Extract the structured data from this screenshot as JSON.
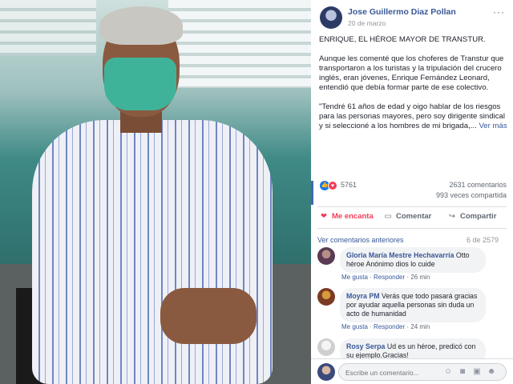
{
  "post": {
    "author": "Jose Guillermo Diaz Pollan",
    "date": "20 de marzo",
    "more": "···",
    "title": "ENRIQUE, EL HÉROE MAYOR DE TRANSTUR.",
    "paragraph1": "Aunque les comenté que los choferes de Transtur que transportaron a los turistas y la tripulación del crucero inglés, eran jóvenes, Enrique Fernández Leonard, entendió que debía formar parte de ese colectivo.",
    "paragraph2": "\"Tendré 61 años de edad y oigo hablar de los riesgos para las personas mayores, pero soy dirigente sindical y si seleccioné a los hombres de mi brigada,...",
    "see_more": "Ver más",
    "reactions": "5761",
    "comments_count": "2631 comentarios",
    "shares_count": "993 veces compartida"
  },
  "actions": {
    "like": "Me encanta",
    "comment": "Comentar",
    "share": "Compartir"
  },
  "comments_header": {
    "previous": "Ver comentarios anteriores",
    "count": "6 de 2579"
  },
  "comments": [
    {
      "name": "Gloria María Mestre Hechavarría",
      "text": "Otto héroe Anónimo dios lo cuide",
      "like": "Me gusta",
      "reply": "Responder",
      "time": "26 min"
    },
    {
      "name": "Moyra PM",
      "text": "Verás que todo pasará gracias por ayudar aquella personas sin duda un acto de humanidad",
      "like": "Me gusta",
      "reply": "Responder",
      "time": "24 min"
    },
    {
      "name": "Rosy Serpa",
      "text": "Ud es un héroe, predicó con su ejemplo.Gracias!"
    }
  ],
  "compose": {
    "placeholder": "Escribe un comentario..."
  },
  "colors": {
    "link": "#385898",
    "love": "#f33e58",
    "like": "#1877f2"
  }
}
